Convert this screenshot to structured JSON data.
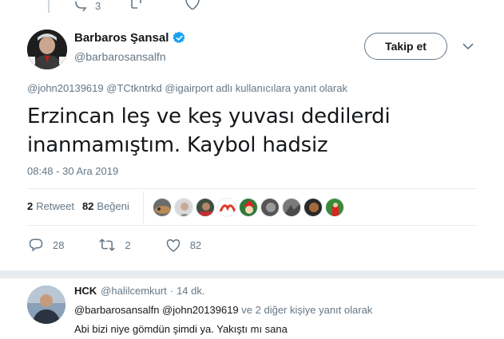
{
  "colors": {
    "text_primary": "#14171a",
    "text_secondary": "#657786",
    "verified_blue": "#1da1f2",
    "divider": "#e6ecf0"
  },
  "prev_tweet": {
    "reply_count": "3"
  },
  "main_tweet": {
    "display_name": "Barbaros Şansal",
    "handle": "@barbarosansalfn",
    "follow_label": "Takip et",
    "reply_context": {
      "mentions": [
        "@john20139619",
        "@TCtkntrkd",
        "@igairport"
      ],
      "suffix": "adlı kullanıcılara yanıt olarak"
    },
    "text_lines": [
      "Erzincan leş ve keş yuvası dedilerdi",
      "inanmamıştım. Kaybol hadsiz"
    ],
    "timestamp": "08:48 - 30 Ara 2019",
    "stats": {
      "retweet_count": "2",
      "retweet_label": "Retweet",
      "like_count": "82",
      "like_label": "Beğeni"
    },
    "likers_icons": [
      "avatar-1",
      "avatar-2",
      "avatar-3",
      "avatar-4",
      "avatar-5",
      "avatar-6",
      "avatar-7",
      "avatar-8",
      "avatar-9"
    ],
    "actions": {
      "reply_count": "28",
      "retweet_count": "2",
      "like_count": "82"
    }
  },
  "reply_tweet": {
    "display_name": "HCK",
    "handle": "@halilcemkurt",
    "dot": "·",
    "time": "14 dk.",
    "context_links": "@barbarosansalfn @john20139619",
    "context_suffix": "ve 2 diğer kişiye yanıt olarak",
    "text": "Abi bizi niye gömdün şimdi ya. Yakıştı mı sana"
  }
}
